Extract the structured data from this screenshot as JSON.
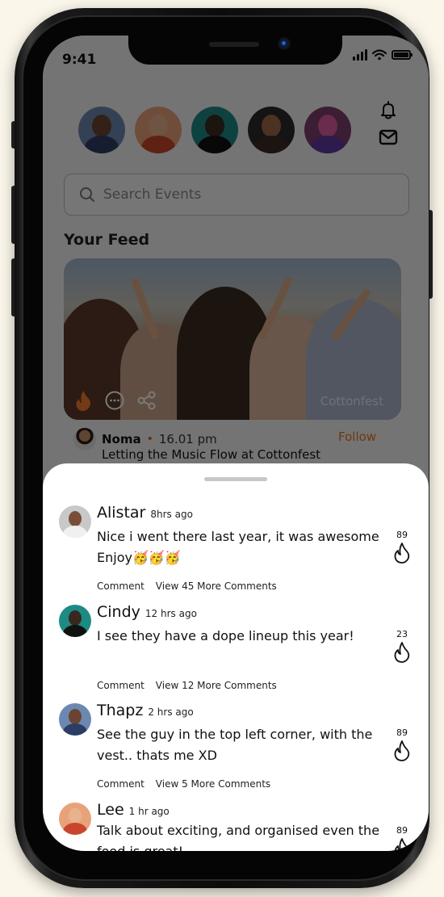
{
  "status_bar": {
    "time": "9:41"
  },
  "search": {
    "placeholder": "Search Events"
  },
  "feed": {
    "title": "Your Feed",
    "post": {
      "author": "Noma",
      "time": "16.01 pm",
      "follow_label": "Follow",
      "caption": "Letting the Music Flow at Cottonfest",
      "image_watermark": "Cottonfest"
    }
  },
  "comments": [
    {
      "name": "Alistar",
      "time": "8hrs ago",
      "text": "Nice i went there last year, it was awesome Enjoy🥳🥳🥳",
      "comment_label": "Comment",
      "more_label": "View 45 More Comments",
      "likes": "89"
    },
    {
      "name": "Cindy",
      "time": "12 hrs ago",
      "text": "I see they have a dope lineup this year!",
      "comment_label": "Comment",
      "more_label": "View 12 More Comments",
      "likes": "23"
    },
    {
      "name": "Thapz",
      "time": "2 hrs ago",
      "text": "See the guy in the top left corner, with the vest.. thats me XD",
      "comment_label": "Comment",
      "more_label": "View 5 More Comments",
      "likes": "89"
    },
    {
      "name": "Lee",
      "time": "1 hr ago",
      "text": "Talk about exciting, and organised even the food is great!",
      "likes": "89"
    }
  ],
  "colors": {
    "accent": "#e8731f",
    "fire_stroke": "#111111"
  }
}
